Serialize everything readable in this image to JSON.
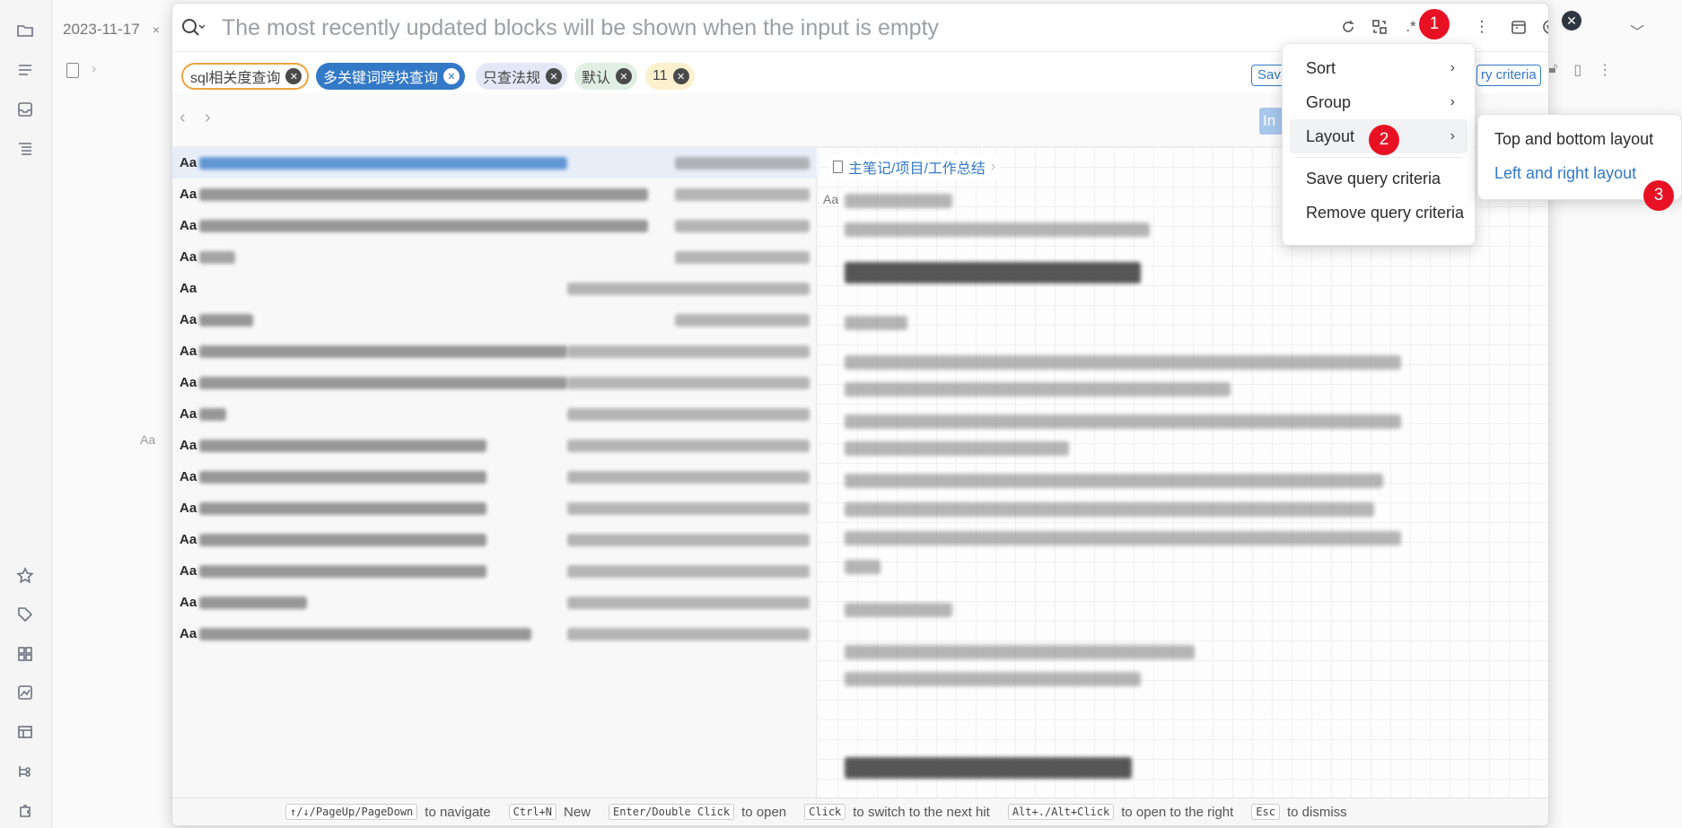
{
  "editor": {
    "tab_title": "2023-11-17",
    "tab_close": "×"
  },
  "search": {
    "placeholder": "The most recently updated blocks will be shown when the input is empty"
  },
  "criteria": {
    "chips": [
      "sql相关度查询",
      "多关键词跨块查询",
      "只查法规",
      "默认",
      "11"
    ],
    "save_fragment": "Sav",
    "criteria_fragment": "ry criteria"
  },
  "nav": {
    "info_fragment": "In"
  },
  "preview": {
    "breadcrumb": "主笔记/项目/工作总结"
  },
  "menu": {
    "items": [
      {
        "label": "Sort"
      },
      {
        "label": "Group"
      },
      {
        "label": "Layout"
      },
      {
        "label": "Save query criteria"
      },
      {
        "label": "Remove query criteria"
      }
    ]
  },
  "layout_submenu": {
    "items": [
      {
        "label": "Top and bottom layout"
      },
      {
        "label": "Left and right layout"
      }
    ]
  },
  "badges": [
    "1",
    "2",
    "3"
  ],
  "footer": {
    "hints": [
      {
        "key": "↑/↓/PageUp/PageDown",
        "label": "to navigate"
      },
      {
        "key": "Ctrl+N",
        "label": "New"
      },
      {
        "key": "Enter/Double Click",
        "label": "to open"
      },
      {
        "key": "Click",
        "label": "to switch to the next hit"
      },
      {
        "key": "Alt+./Alt+Click",
        "label": "to open to the right"
      },
      {
        "key": "Esc",
        "label": "to dismiss"
      }
    ]
  },
  "result_icon": "Aa",
  "colors": {
    "accent": "#3479c7",
    "badge": "#e81123",
    "chip_highlight_border": "#f0a33b"
  }
}
